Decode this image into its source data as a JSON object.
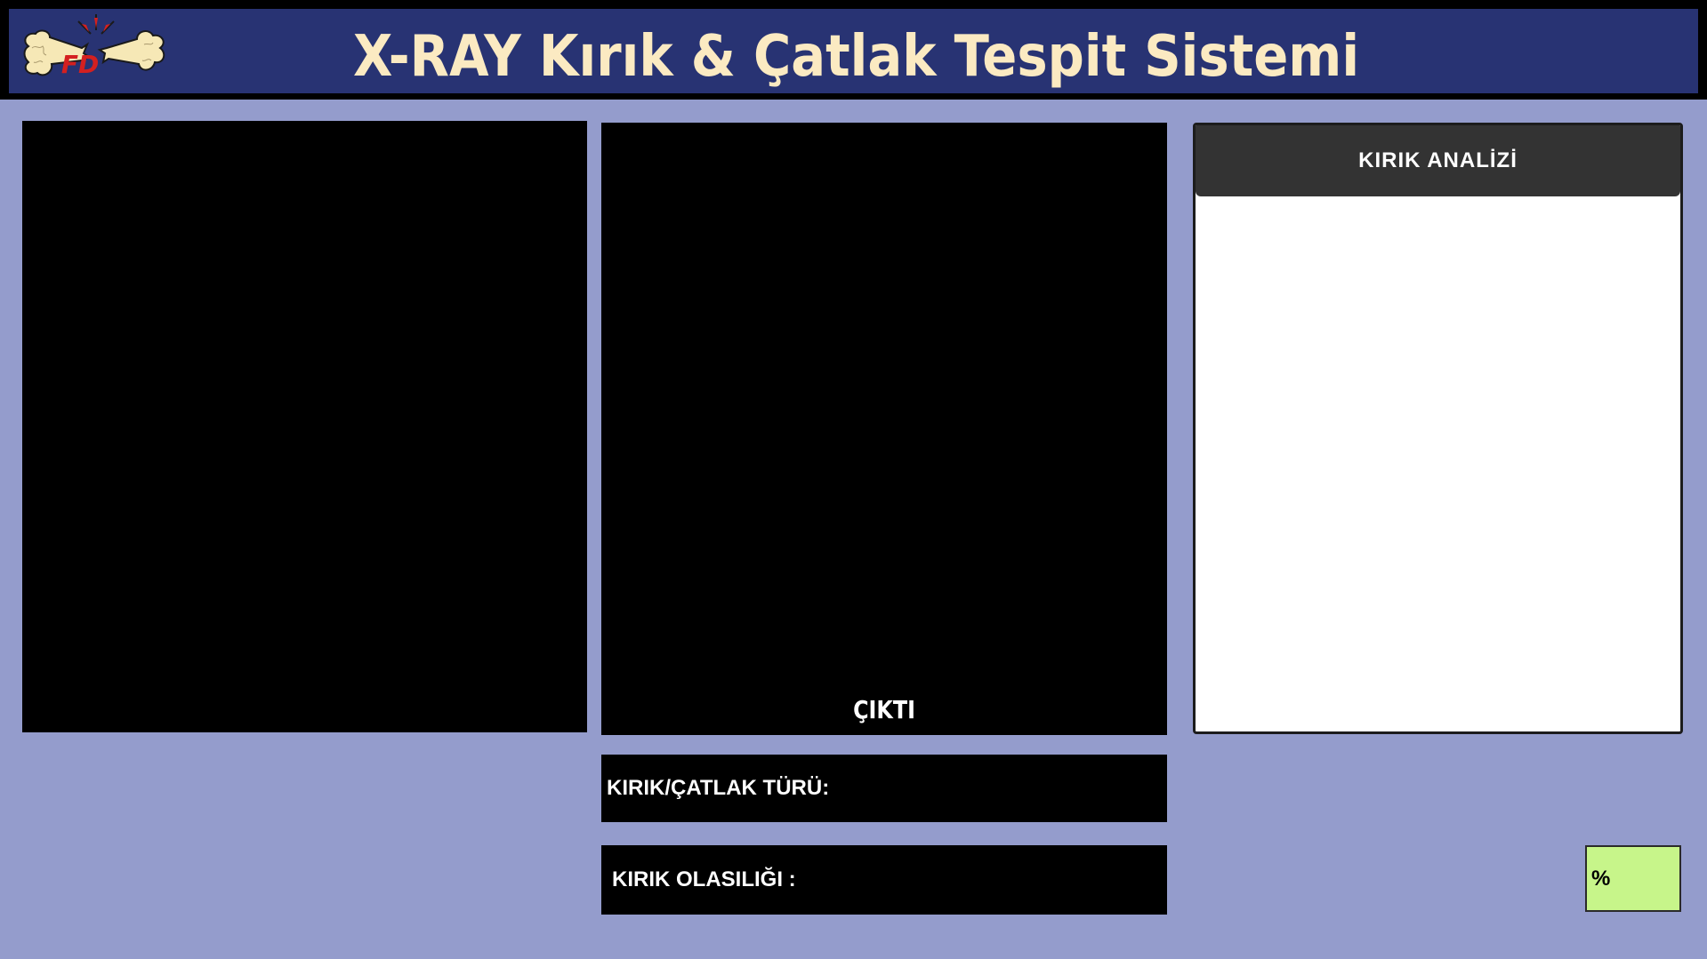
{
  "header": {
    "title": "X-RAY Kırık & Çatlak Tespit Sistemi",
    "logo_text": "FD"
  },
  "output_panel": {
    "label": "ÇIKTI"
  },
  "fields": {
    "fracture_type_label": "KIRIK/ÇATLAK TÜRÜ:",
    "fracture_probability_label": "KIRIK OLASILIĞI :"
  },
  "analysis": {
    "title": "KIRIK ANALİZİ"
  },
  "percent_box": {
    "text": "%"
  },
  "colors": {
    "background": "#949ccc",
    "header_bg": "#283373",
    "title_color": "#fbeac2",
    "percent_box_bg": "#c7f58a",
    "analysis_header_bg": "#333333"
  },
  "icons": {
    "logo": "broken-bone-icon"
  }
}
